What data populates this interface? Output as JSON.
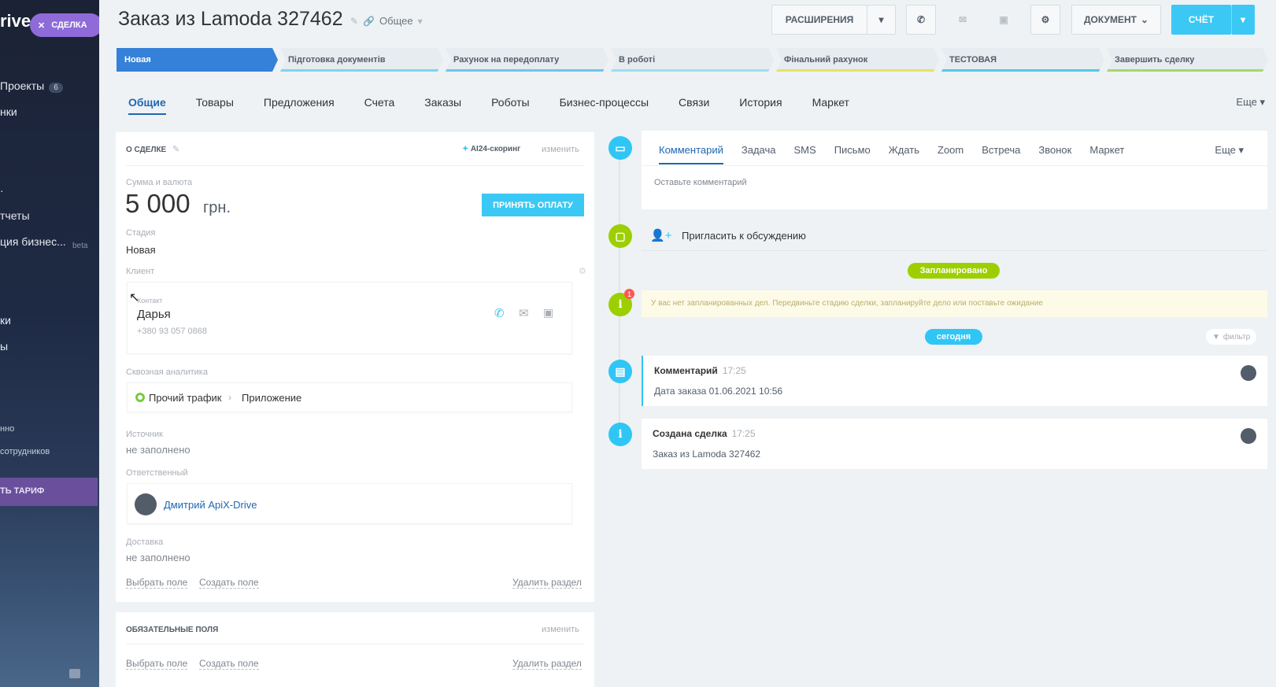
{
  "sidebar": {
    "logo": "rive",
    "chip_label": "СДЕЛКА",
    "items": [
      {
        "label": "Проекты",
        "badge": "6"
      },
      {
        "label": "нки"
      },
      {
        "label": "·"
      },
      {
        "label": "тчеты"
      },
      {
        "label": "ция бизнес..."
      },
      {
        "label": "ки"
      },
      {
        "label": "ы"
      },
      {
        "label": "нно"
      },
      {
        "label": "сотрудников"
      }
    ],
    "beta": "beta",
    "tariff": "ТЬ ТАРИФ"
  },
  "header": {
    "title": "Заказ из Lamoda  327462",
    "category": "Общее",
    "buttons": {
      "extensions": "РАСШИРЕНИЯ",
      "document": "ДОКУМЕНТ",
      "invoice": "СЧЁТ"
    }
  },
  "stages": [
    {
      "label": "Новая",
      "color": "#3580d8"
    },
    {
      "label": "Підготовка документів",
      "color": "#7fd3f0"
    },
    {
      "label": "Рахунок на передоплату",
      "color": "#6fc4f0"
    },
    {
      "label": "В роботі",
      "color": "#9edcf4"
    },
    {
      "label": "Фінальний рахунок",
      "color": "#e8e06a"
    },
    {
      "label": "ТЕСТОВАЯ",
      "color": "#55c7e8"
    },
    {
      "label": "Завершить сделку",
      "color": "#a6d86a"
    }
  ],
  "tabs": [
    "Общие",
    "Товары",
    "Предложения",
    "Счета",
    "Заказы",
    "Роботы",
    "Бизнес-процессы",
    "Связи",
    "История",
    "Маркет"
  ],
  "tabs_more": "Еще",
  "deal": {
    "section_title": "О СДЕЛКЕ",
    "ai_scoring": "AI24-скоринг",
    "change": "изменить",
    "amount_label": "Сумма и валюта",
    "amount": "5 000",
    "currency": "грн.",
    "accept_payment": "ПРИНЯТЬ ОПЛАТУ",
    "stage_label": "Стадия",
    "stage_value": "Новая",
    "client_label": "Клиент",
    "contact_label": "Контакт",
    "contact_name": "Дарья",
    "contact_phone": "+380 93 057 0868",
    "analytics_label": "Сквозная аналитика",
    "analytics_source": "Прочий трафик",
    "analytics_target": "Приложение",
    "source_label": "Источник",
    "source_value": "не заполнено",
    "responsible_label": "Ответственный",
    "responsible_name": "Дмитрий ApiX-Drive",
    "delivery_label": "Доставка",
    "delivery_value": "не заполнено",
    "select_field": "Выбрать поле",
    "create_field": "Создать поле",
    "delete_section": "Удалить раздел"
  },
  "required": {
    "section_title": "ОБЯЗАТЕЛЬНЫЕ ПОЛЯ",
    "change": "изменить",
    "select_field": "Выбрать поле",
    "create_field": "Создать поле",
    "delete_section": "Удалить раздел"
  },
  "composer": {
    "tabs": [
      "Комментарий",
      "Задача",
      "SMS",
      "Письмо",
      "Ждать",
      "Zoom",
      "Встреча",
      "Звонок",
      "Маркет"
    ],
    "more": "Еще",
    "placeholder": "Оставьте комментарий"
  },
  "invite": "Пригласить к обсуждению",
  "planned_pill": "Запланировано",
  "planned_notice": "У вас нет запланированных дел. Передвиньте стадию сделки, запланируйте дело или поставьте ожидание",
  "notice_badge": "1",
  "today_pill": "сегодня",
  "filter": "фильтр",
  "feed": [
    {
      "title": "Комментарий",
      "time": "17:25",
      "body": "Дата заказа 01.06.2021 10:56"
    },
    {
      "title": "Создана сделка",
      "time": "17:25",
      "body": "Заказ из Lamoda 327462"
    }
  ]
}
